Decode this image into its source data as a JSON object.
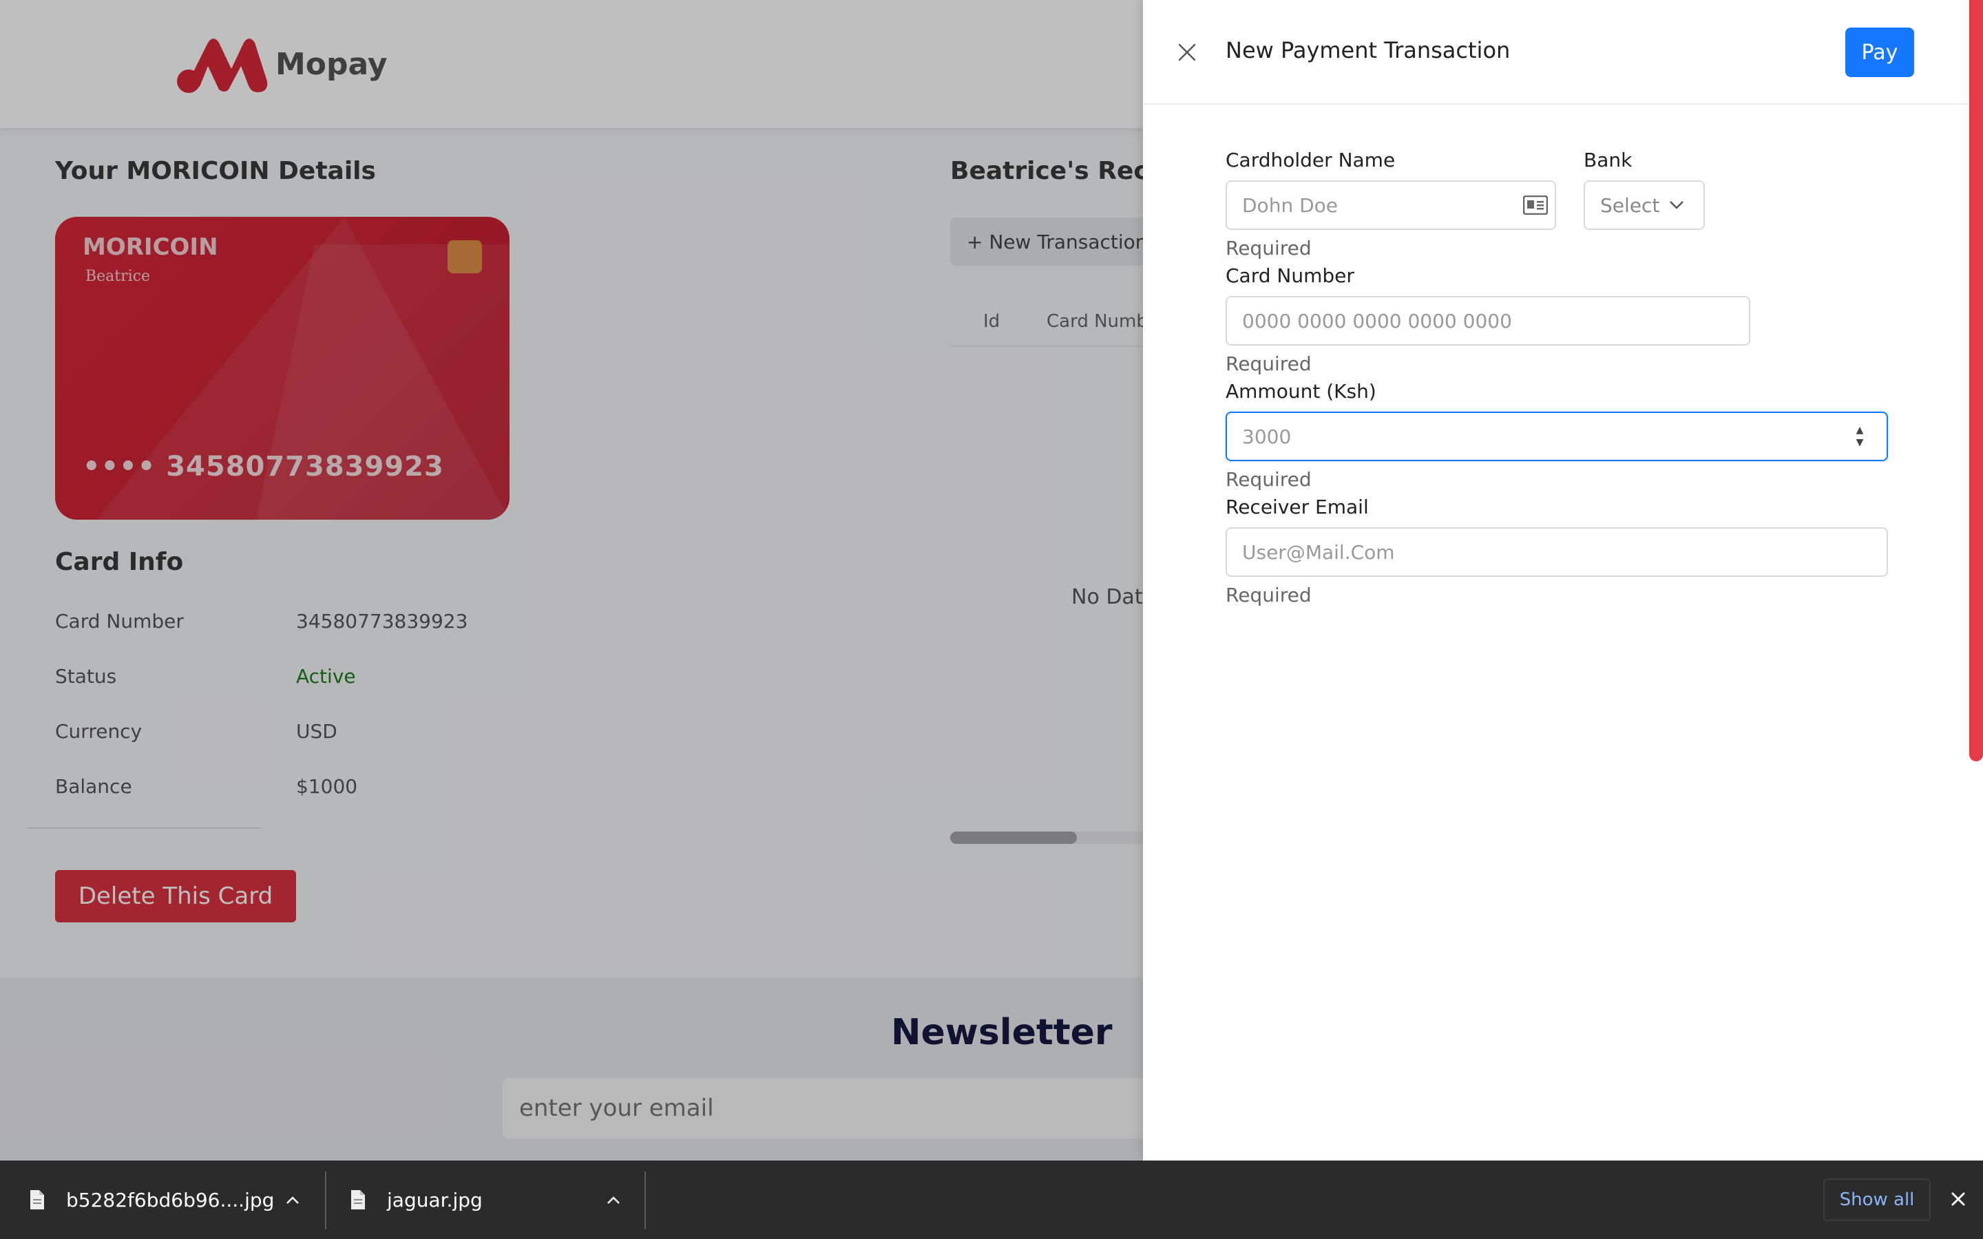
{
  "app": {
    "brand": "Mopay"
  },
  "card_section": {
    "title": "Your MORICOIN Details",
    "card": {
      "brand": "MORICOIN",
      "holder": "Beatrice",
      "number": "•••• 34580773839923"
    }
  },
  "card_info": {
    "title": "Card Info",
    "rows": [
      {
        "label": "Card Number",
        "value": "34580773839923"
      },
      {
        "label": "Status",
        "value": "Active"
      },
      {
        "label": "Currency",
        "value": "USD"
      },
      {
        "label": "Balance",
        "value": "$1000"
      }
    ],
    "delete_label": "Delete This Card"
  },
  "transactions": {
    "title": "Beatrice's Rece",
    "new_label": "+ New Transaction",
    "columns": [
      "Id",
      "Card Numb"
    ],
    "empty_text": "No Data"
  },
  "newsletter": {
    "title": "Newsletter",
    "placeholder": "enter your email"
  },
  "drawer": {
    "title": "New Payment Transaction",
    "pay_label": "Pay",
    "fields": {
      "cardholder": {
        "label": "Cardholder Name",
        "placeholder": "Dohn Doe",
        "hint": "Required"
      },
      "bank": {
        "label": "Bank",
        "selected": "Select"
      },
      "card_number": {
        "label": "Card Number",
        "placeholder": "0000 0000 0000 0000 0000",
        "hint": "Required"
      },
      "amount": {
        "label": "Ammount (Ksh)",
        "placeholder": "3000",
        "hint": "Required"
      },
      "email": {
        "label": "Receiver Email",
        "placeholder": "User@Mail.Com",
        "hint": "Required"
      }
    }
  },
  "downloads": {
    "items": [
      {
        "name": "b5282f6bd6b96....jpg"
      },
      {
        "name": "jaguar.jpg"
      }
    ],
    "show_all": "Show all"
  },
  "colors": {
    "accent": "#1677ff",
    "danger": "#d8323f",
    "status_active": "#1f7a1f",
    "card_red": "#c11d2e"
  }
}
